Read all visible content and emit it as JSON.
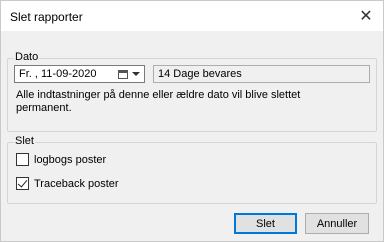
{
  "window": {
    "title": "Slet rapporter",
    "close_glyph": "✕"
  },
  "dato_group": {
    "label": "Dato",
    "date_value": "Fr. , 11-09-2020",
    "date_icon": "calendar-icon",
    "days_retained": "14 Dage bevares",
    "info_line1": "Alle indtastninger på denne eller ældre dato vil blive slettet",
    "info_line2": "permanent."
  },
  "slet_group": {
    "label": "Slet",
    "options": [
      {
        "label": "logbogs poster",
        "checked": false
      },
      {
        "label": "Traceback poster",
        "checked": true
      }
    ]
  },
  "buttons": {
    "delete": "Slet",
    "cancel": "Annuller"
  }
}
